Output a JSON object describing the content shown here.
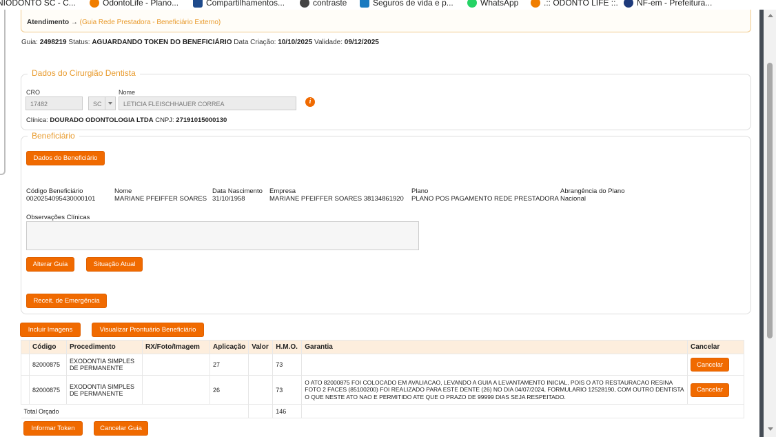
{
  "bookmarks": [
    {
      "label": "NIODONTO SC - C...",
      "color": "#ffffff"
    },
    {
      "label": "OdontoLife - Plano...",
      "color": "#f07d00"
    },
    {
      "label": "Compartilhamentos...",
      "color": "#1e4a8c"
    },
    {
      "label": "contraste",
      "color": "#444444"
    },
    {
      "label": "Seguros de vida e p...",
      "color": "#1a7ac0"
    },
    {
      "label": "WhatsApp",
      "color": "#25d366"
    },
    {
      "label": ".:: ODONTO LIFE ::.",
      "color": "#f07d00"
    },
    {
      "label": "NF-em - Prefeitura...",
      "color": "#1e3a7c"
    }
  ],
  "breadcrumb": {
    "main": "Atendimento →",
    "sub": "(Guia Rede Prestadora - Beneficiário Externo)"
  },
  "guia": {
    "guia_label": "Guia:",
    "guia_value": "2498219",
    "status_label": "Status:",
    "status_value": "AGUARDANDO TOKEN DO BENEFICIÁRIO",
    "criacao_label": "Data Criação:",
    "criacao_value": "10/10/2025",
    "validade_label": "Validade:",
    "validade_value": "09/12/2025"
  },
  "dentista": {
    "legend": "Dados do Cirurgião Dentista",
    "cro_label": "CRO",
    "cro_value": "17482",
    "uf_value": "SC",
    "nome_label": "Nome",
    "nome_value": "LETICIA FLEISCHHAUER CORREA",
    "clinica_label": "Clínica:",
    "clinica_value": "DOURADO ODONTOLOGIA LTDA",
    "cnpj_label": "CNPJ:",
    "cnpj_value": "27191015000130",
    "info_icon": "i"
  },
  "beneficiario": {
    "legend": "Beneficiário",
    "dados_button": "Dados do Beneficiário",
    "codigo_label": "Código Beneficiário",
    "codigo_value": "0020254095430000101",
    "nome_label": "Nome",
    "nome_value": "MARIANE PFEIFFER SOARES",
    "nasc_label": "Data Nascimento",
    "nasc_value": "31/10/1958",
    "empresa_label": "Empresa",
    "empresa_value": "MARIANE PFEIFFER SOARES 38134861920",
    "plano_label": "Plano",
    "plano_value": "PLANO POS PAGAMENTO REDE PRESTADORA",
    "abrangencia_label": "Abrangência do Plano",
    "abrangencia_value": "Nacional",
    "obs_label": "Observações Clínicas",
    "alterar_button": "Alterar Guia",
    "situacao_button": "Situação Atual",
    "receit_button": "Receit. de Emergência"
  },
  "actions": {
    "incluir_imagens": "Incluir Imagens",
    "visualizar_prontuario": "Visualizar Prontuário Beneficiário"
  },
  "table": {
    "headers": [
      "Código",
      "Procedimento",
      "RX/Foto/Imagem",
      "Aplicação",
      "Valor",
      "H.M.O.",
      "Garantia",
      "Cancelar"
    ],
    "rows": [
      {
        "codigo": "82000875",
        "procedimento": "EXODONTIA SIMPLES DE PERMANENTE",
        "rx": "",
        "aplicacao": "27",
        "valor": "",
        "hmo": "73",
        "garantia": "",
        "cancelar": "Cancelar"
      },
      {
        "codigo": "82000875",
        "procedimento": "EXODONTIA SIMPLES DE PERMANENTE",
        "rx": "",
        "aplicacao": "26",
        "valor": "",
        "hmo": "73",
        "garantia": "O ATO 82000875 FOI COLOCADO EM AVALIACAO, LEVANDO A GUIA A LEVANTAMENTO INICIAL, POIS O ATO RESTAURACAO RESINA FOTO 2 FACES (85100200) FOI REALIZADO PARA ESTE DENTE (26) NO DIA 04/07/2024, FORMULARIO 12528190, COM OUTRO DENTISTA O QUE NESTE ATO NAO E PERMITIDO ATE QUE O PRAZO DE 99999 DIAS SEJA RESPEITADO.",
        "cancelar": "Cancelar"
      }
    ],
    "total_label": "Total Orçado",
    "total_value": "146"
  },
  "footer": {
    "informar_token": "Informar Token",
    "cancelar_guia": "Cancelar Guia"
  }
}
